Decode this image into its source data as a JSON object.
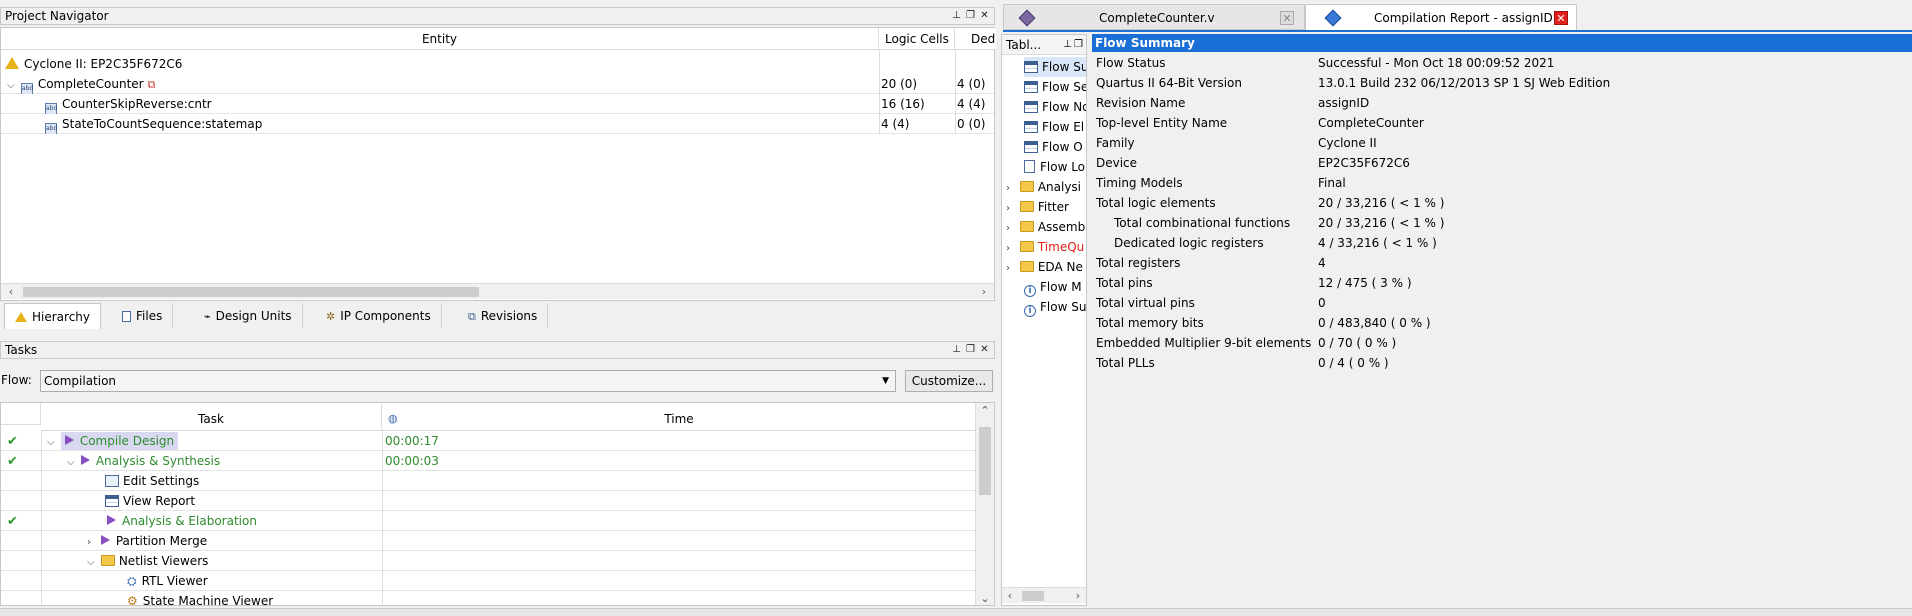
{
  "project_navigator": {
    "title": "Project Navigator",
    "columns": [
      "Entity",
      "Logic Cells",
      "Ded"
    ],
    "device_row": "Cyclone II: EP2C35F672C6",
    "rows": [
      {
        "entity": "CompleteCounter",
        "cells": "20 (0)",
        "ded": "4 (0)"
      },
      {
        "entity": "CounterSkipReverse:cntr",
        "cells": "16 (16)",
        "ded": "4 (4)"
      },
      {
        "entity": "StateToCountSequence:statemap",
        "cells": "4 (4)",
        "ded": "0 (0)"
      }
    ],
    "tabs": [
      "Hierarchy",
      "Files",
      "Design Units",
      "IP Components",
      "Revisions"
    ]
  },
  "tasks": {
    "title": "Tasks",
    "flow_label": "Flow:",
    "flow_value": "Compilation",
    "customize_label": "Customize...",
    "columns": [
      "Task",
      "Time"
    ],
    "rows": [
      {
        "label": "Compile Design",
        "time": "00:00:17"
      },
      {
        "label": "Analysis & Synthesis",
        "time": "00:00:03"
      },
      {
        "label": "Edit Settings",
        "time": ""
      },
      {
        "label": "View Report",
        "time": ""
      },
      {
        "label": "Analysis & Elaboration",
        "time": ""
      },
      {
        "label": "Partition Merge",
        "time": ""
      },
      {
        "label": "Netlist Viewers",
        "time": ""
      },
      {
        "label": "RTL Viewer",
        "time": ""
      },
      {
        "label": "State Machine Viewer",
        "time": ""
      }
    ]
  },
  "doc_tabs": [
    {
      "label": "CompleteCounter.v"
    },
    {
      "label": "Compilation Report - assignID"
    }
  ],
  "toc": {
    "header": "Tabl...",
    "items": [
      "Flow Su",
      "Flow Se",
      "Flow No",
      "Flow El",
      "Flow O",
      "Flow Lo",
      "Analysi",
      "Fitter",
      "Assemb",
      "TimeQu",
      "EDA Ne",
      "Flow M",
      "Flow Su"
    ]
  },
  "flow_summary": {
    "title": "Flow Summary",
    "rows": [
      {
        "label": "Flow Status",
        "value": "Successful - Mon Oct 18 00:09:52 2021"
      },
      {
        "label": "Quartus II 64-Bit Version",
        "value": "13.0.1 Build 232 06/12/2013 SP 1 SJ Web Edition"
      },
      {
        "label": "Revision Name",
        "value": "assignID"
      },
      {
        "label": "Top-level Entity Name",
        "value": "CompleteCounter"
      },
      {
        "label": "Family",
        "value": "Cyclone II"
      },
      {
        "label": "Device",
        "value": "EP2C35F672C6"
      },
      {
        "label": "Timing Models",
        "value": "Final"
      },
      {
        "label": "Total logic elements",
        "value": "20 / 33,216 ( < 1 % )"
      },
      {
        "label": "Total combinational functions",
        "value": "20 / 33,216 ( < 1 % )"
      },
      {
        "label": "Dedicated logic registers",
        "value": "4 / 33,216 ( < 1 % )"
      },
      {
        "label": "Total registers",
        "value": "4"
      },
      {
        "label": "Total pins",
        "value": "12 / 475 ( 3 % )"
      },
      {
        "label": "Total virtual pins",
        "value": "0"
      },
      {
        "label": "Total memory bits",
        "value": "0 / 483,840 ( 0 % )"
      },
      {
        "label": "Embedded Multiplier 9-bit elements",
        "value": "0 / 70 ( 0 % )"
      },
      {
        "label": "Total PLLs",
        "value": "0 / 4 ( 0 % )"
      }
    ]
  },
  "colors": {
    "accent": "#1a6fd6",
    "success": "#2e8b2e",
    "warning": "#e0201a"
  }
}
